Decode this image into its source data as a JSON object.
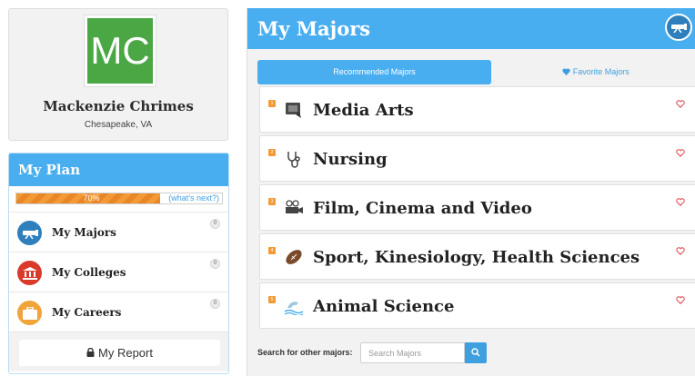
{
  "profile": {
    "initials": "MC",
    "name": "Mackenzie Chrimes",
    "location": "Chesapeake, VA",
    "avatar_color": "#4aa744"
  },
  "plan": {
    "title": "My Plan",
    "progress_percent": 70,
    "progress_label": "70%",
    "whats_next": "(what's next?)",
    "items": [
      {
        "label": "My Majors",
        "count": "0",
        "icon": "telescope-icon",
        "color": "#2e7fbb"
      },
      {
        "label": "My Colleges",
        "count": "0",
        "icon": "building-icon",
        "color": "#d93a2b"
      },
      {
        "label": "My Careers",
        "count": "0",
        "icon": "briefcase-icon",
        "color": "#f0a43a"
      }
    ],
    "report_label": "My Report"
  },
  "majors": {
    "title": "My Majors",
    "tabs": {
      "recommended": "Recommended Majors",
      "favorite": "Favorite Majors"
    },
    "items": [
      {
        "rank": "1",
        "name": "Media Arts",
        "icon": "media-icon"
      },
      {
        "rank": "2",
        "name": "Nursing",
        "icon": "stethoscope-icon"
      },
      {
        "rank": "3",
        "name": "Film, Cinema and Video",
        "icon": "film-camera-icon"
      },
      {
        "rank": "4",
        "name": "Sport, Kinesiology, Health Sciences",
        "icon": "football-icon"
      },
      {
        "rank": "5",
        "name": "Animal Science",
        "icon": "dolphin-icon"
      }
    ],
    "search": {
      "label": "Search for other majors:",
      "placeholder": "Search Majors"
    }
  },
  "colors": {
    "accent": "#48aef0",
    "rank_badge": "#f39a37",
    "heart": "#e0505a"
  }
}
